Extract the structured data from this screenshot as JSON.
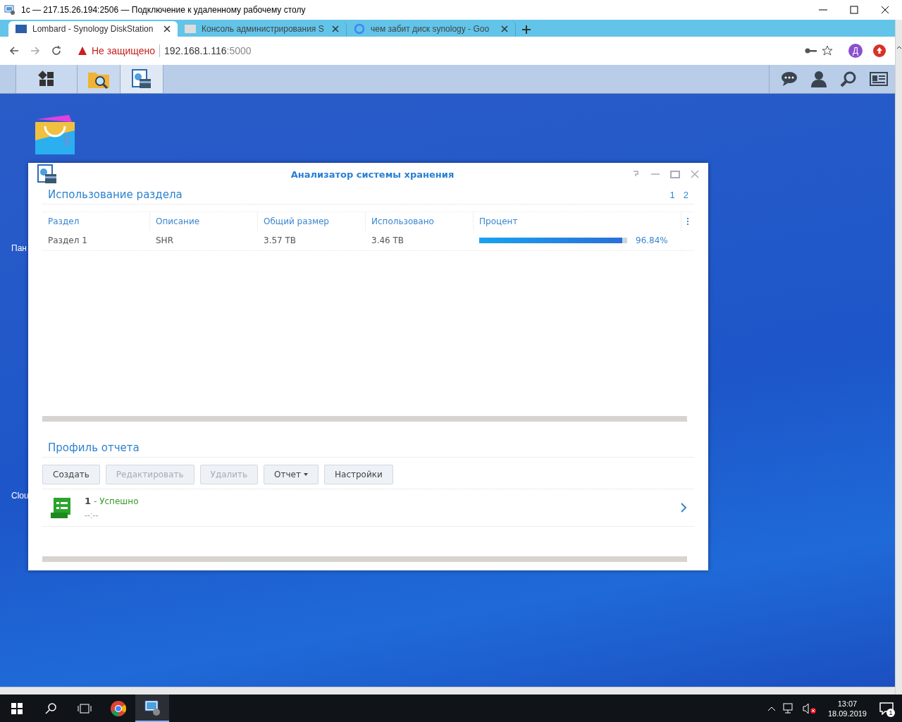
{
  "rdp_window": {
    "title": "1с — 217.15.26.194:2506 — Подключение к удаленному рабочему столу"
  },
  "browser": {
    "tabs": [
      {
        "label": "Lombard - Synology DiskStation",
        "kind": "dsm",
        "selected": true
      },
      {
        "label": "Консоль администрирования S",
        "kind": "syno",
        "selected": false
      },
      {
        "label": "чем забит диск synology - Goo",
        "kind": "google",
        "selected": false
      }
    ],
    "security_label": "Не защищено",
    "url_host": "192.168.1.116",
    "url_port": ":5000",
    "profile_initial": "Д"
  },
  "dsm_taskbar": {
    "apps": [
      {
        "kind": "main-menu",
        "selected": false
      },
      {
        "kind": "file-station",
        "selected": false
      },
      {
        "kind": "storage-analyzer",
        "selected": true
      }
    ]
  },
  "desktop": {
    "labels": [
      "Пан",
      "Clou"
    ]
  },
  "app_window": {
    "title": "Анализатор системы хранения",
    "usage_title": "Использование раздела",
    "pages": [
      "1",
      "2"
    ],
    "table": {
      "columns": [
        "Раздел",
        "Описание",
        "Общий размер",
        "Использовано",
        "Процент"
      ],
      "rows": [
        {
          "cells": [
            "Раздел 1",
            "SHR",
            "3.57 TB",
            "3.46 TB"
          ],
          "level": 0.9684,
          "percent": "96.84%"
        }
      ]
    },
    "profile_title": "Профиль отчета",
    "buttons": [
      {
        "label": "Создать",
        "kind": "plain",
        "disabled": false
      },
      {
        "label": "Редактировать",
        "kind": "plain",
        "disabled": true
      },
      {
        "label": "Удалить",
        "kind": "plain",
        "disabled": true
      },
      {
        "label": "Отчет",
        "kind": "dropdown",
        "disabled": false
      },
      {
        "label": "Настройки",
        "kind": "plain",
        "disabled": false
      }
    ],
    "reports": [
      {
        "number": "1",
        "status": "- Успешно",
        "time": "--:--"
      }
    ]
  },
  "taskbar": {
    "time": "13:07",
    "date": "18.09.2019",
    "notifications": "1"
  }
}
